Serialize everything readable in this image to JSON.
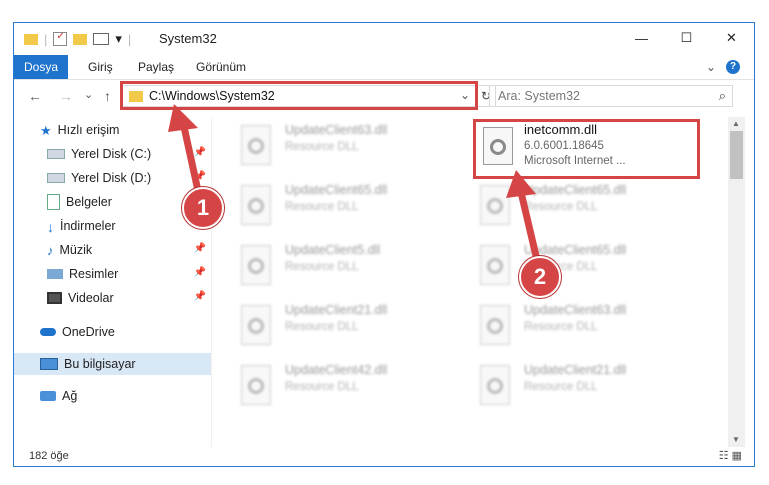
{
  "window": {
    "title": "System32",
    "controls": {
      "minimize": "—",
      "maximize": "☐",
      "close": "✕"
    }
  },
  "quick_access_toolbar": {
    "dropdown": "▾"
  },
  "ribbon": {
    "tabs": [
      {
        "label": "Dosya",
        "active": true
      },
      {
        "label": "Giriş"
      },
      {
        "label": "Paylaş"
      },
      {
        "label": "Görünüm"
      }
    ],
    "expand_glyph": "⌄",
    "help_glyph": "?"
  },
  "address_bar": {
    "path": "C:\\Windows\\System32",
    "dropdown_glyph": "⌄",
    "refresh_glyph": "↻"
  },
  "nav_buttons": {
    "back": "←",
    "forward": "→",
    "recent": "⌄",
    "up": "↑"
  },
  "search": {
    "placeholder": "Ara: System32",
    "icon_glyph": "⌕"
  },
  "sidebar": {
    "items": [
      {
        "label": "Hızlı erişim",
        "icon": "star-icon",
        "pinned": false
      },
      {
        "label": "Yerel Disk (C:)",
        "icon": "drive-icon",
        "pinned": true
      },
      {
        "label": "Yerel Disk (D:)",
        "icon": "drive-icon",
        "pinned": true
      },
      {
        "label": "Belgeler",
        "icon": "document-icon",
        "pinned": true
      },
      {
        "label": "İndirmeler",
        "icon": "download-icon",
        "pinned": true
      },
      {
        "label": "Müzik",
        "icon": "music-icon",
        "pinned": true
      },
      {
        "label": "Resimler",
        "icon": "pictures-icon",
        "pinned": true
      },
      {
        "label": "Videolar",
        "icon": "video-icon",
        "pinned": true
      },
      {
        "label": "OneDrive",
        "icon": "cloud-icon",
        "pinned": false
      },
      {
        "label": "Bu bilgisayar",
        "icon": "computer-icon",
        "pinned": false,
        "selected": true
      },
      {
        "label": "Ağ",
        "icon": "network-icon",
        "pinned": false
      }
    ],
    "pin_glyph": "📌"
  },
  "files": {
    "left_column": [
      {
        "name": "UpdateClient63.dll",
        "type": "Resource DLL"
      },
      {
        "name": "UpdateClient65.dll",
        "type": "Resource DLL"
      },
      {
        "name": "UpdateClient5.dll",
        "type": "Resource DLL"
      },
      {
        "name": "UpdateClient21.dll",
        "type": "Resource DLL"
      },
      {
        "name": "UpdateClient42.dll",
        "type": "Resource DLL"
      }
    ],
    "right_column": [
      {
        "name": "UpdateClient65.dll",
        "type": "Resource DLL"
      },
      {
        "name": "UpdateClient65.dll",
        "type": "Resource DLL"
      },
      {
        "name": "UpdateClient63.dll",
        "type": "Resource DLL"
      },
      {
        "name": "UpdateClient21.dll",
        "type": "Resource DLL"
      }
    ],
    "highlighted": {
      "name": "inetcomm.dll",
      "version": "6.0.6001.18645",
      "description": "Microsoft Internet ..."
    }
  },
  "status_bar": {
    "item_count": "182 öğe",
    "views_glyph": "☷ ▦"
  },
  "annotations": {
    "marker_1": "1",
    "marker_2": "2",
    "color": "#d64545"
  }
}
